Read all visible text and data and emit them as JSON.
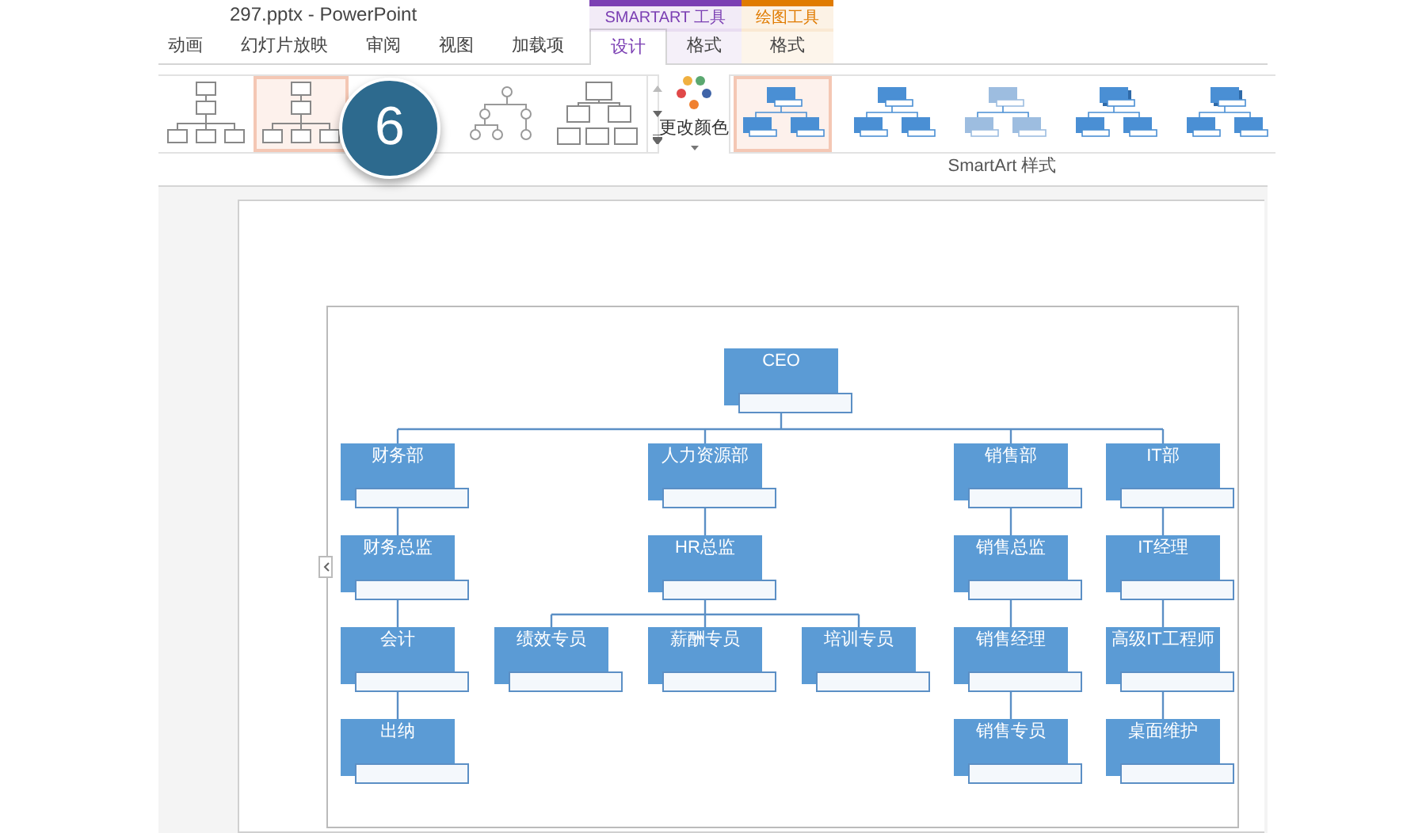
{
  "window": {
    "title": "297.pptx - PowerPoint"
  },
  "tabs": [
    {
      "label": "动画",
      "selected": false
    },
    {
      "label": "幻灯片放映",
      "selected": false
    },
    {
      "label": "审阅",
      "selected": false
    },
    {
      "label": "视图",
      "selected": false
    },
    {
      "label": "加载项",
      "selected": false
    }
  ],
  "context_tabs": [
    {
      "label": "SMARTART 工具",
      "color": "#7b3fb3",
      "tabs": [
        {
          "label": "设计",
          "selected": true
        },
        {
          "label": "格式",
          "selected": false
        }
      ]
    },
    {
      "label": "绘图工具",
      "color": "#e07b00",
      "tabs": [
        {
          "label": "格式",
          "selected": false
        }
      ]
    }
  ],
  "layout_gallery": {
    "items": [
      {
        "kind": "hierarchy",
        "selected": false
      },
      {
        "kind": "hierarchy",
        "selected": true
      },
      {
        "kind": "circles",
        "selected": false
      },
      {
        "kind": "boxes",
        "selected": false
      }
    ]
  },
  "change_colors": {
    "label": "更改颜色"
  },
  "style_gallery": {
    "label": "SmartArt 样式",
    "items": [
      {
        "kind": "flat",
        "selected": true
      },
      {
        "kind": "flat",
        "selected": false
      },
      {
        "kind": "light",
        "selected": false
      },
      {
        "kind": "shadow",
        "selected": false
      },
      {
        "kind": "shadow",
        "selected": false
      }
    ]
  },
  "step_badge": "6",
  "org_chart": {
    "name": "CEO",
    "children": [
      {
        "name": "财务部",
        "children": [
          {
            "name": "财务总监",
            "children": [
              {
                "name": "会计",
                "children": [
                  {
                    "name": "出纳"
                  }
                ]
              }
            ]
          }
        ]
      },
      {
        "name": "人力资源部",
        "children": [
          {
            "name": "HR总监",
            "children": [
              {
                "name": "绩效专员"
              },
              {
                "name": "薪酬专员"
              },
              {
                "name": "培训专员"
              }
            ]
          }
        ]
      },
      {
        "name": "销售部",
        "children": [
          {
            "name": "销售总监",
            "children": [
              {
                "name": "销售经理",
                "children": [
                  {
                    "name": "销售专员"
                  }
                ]
              }
            ]
          }
        ]
      },
      {
        "name": "IT部",
        "children": [
          {
            "name": "IT经理",
            "children": [
              {
                "name": "高级IT工程师",
                "children": [
                  {
                    "name": "桌面维护"
                  }
                ]
              }
            ]
          }
        ]
      }
    ]
  }
}
